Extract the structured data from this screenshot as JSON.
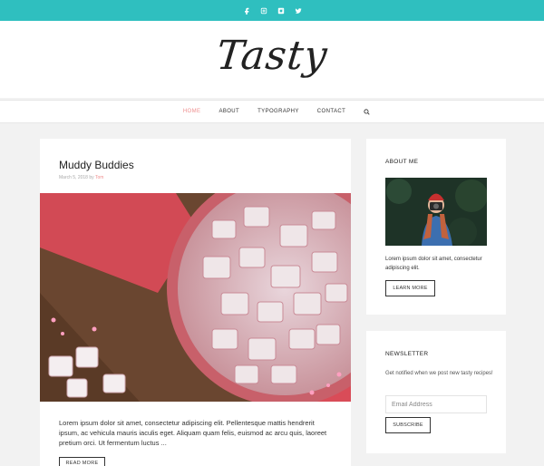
{
  "colors": {
    "accent": "#2fbfbf",
    "highlight": "#ef8f8f"
  },
  "topbar": {
    "icons": [
      "facebook-icon",
      "instagram-icon",
      "instagram-alt-icon",
      "twitter-icon"
    ]
  },
  "site": {
    "logo": "Tasty"
  },
  "nav": {
    "items": [
      "HOME",
      "ABOUT",
      "TYPOGRAPHY",
      "CONTACT"
    ],
    "active": "HOME",
    "search_icon": "search-icon"
  },
  "post": {
    "title": "Muddy Buddies",
    "date": "March 5, 2018",
    "by": "by",
    "author": "Tom",
    "excerpt": "Lorem ipsum dolor sit amet, consectetur adipiscing elit. Pellentesque mattis hendrerit ipsum, ac vehicula mauris iaculis eget. Aliquam quam felis, euismod ac arcu quis, laoreet pretium orci. Ut fermentum luctus ...",
    "read_more": "READ MORE"
  },
  "about": {
    "title": "ABOUT ME",
    "text": "Lorem ipsum dolor sit amet, consectetur adipiscing elit.",
    "button": "LEARN MORE"
  },
  "newsletter": {
    "title": "NEWSLETTER",
    "text": "Get notified when we post new tasty recipes!",
    "email_placeholder": "Email Address",
    "button": "SUBSCRIBE"
  }
}
